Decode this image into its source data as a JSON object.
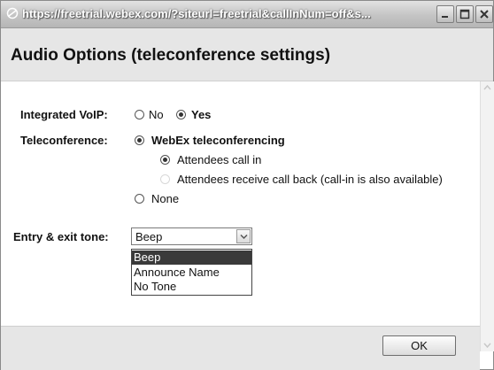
{
  "window": {
    "title": "https://freetrial.webex.com/?siteurl=freetrial&callInNum=off&s..."
  },
  "header": {
    "title": "Audio Options (teleconference settings)"
  },
  "voip": {
    "label": "Integrated VoIP:",
    "options": [
      "No",
      "Yes"
    ],
    "selected": "Yes"
  },
  "teleconference": {
    "label": "Teleconference:",
    "webex_label": "WebEx teleconferencing",
    "call_in_label": "Attendees call in",
    "call_back_label": "Attendees receive call back (call-in is also available)",
    "none_label": "None",
    "selected": "WebEx teleconferencing",
    "sub_selected": "Attendees call in"
  },
  "tone": {
    "label": "Entry & exit tone:",
    "value": "Beep",
    "options": [
      "Beep",
      "Announce Name",
      "No Tone"
    ]
  },
  "footer": {
    "ok_label": "OK"
  }
}
